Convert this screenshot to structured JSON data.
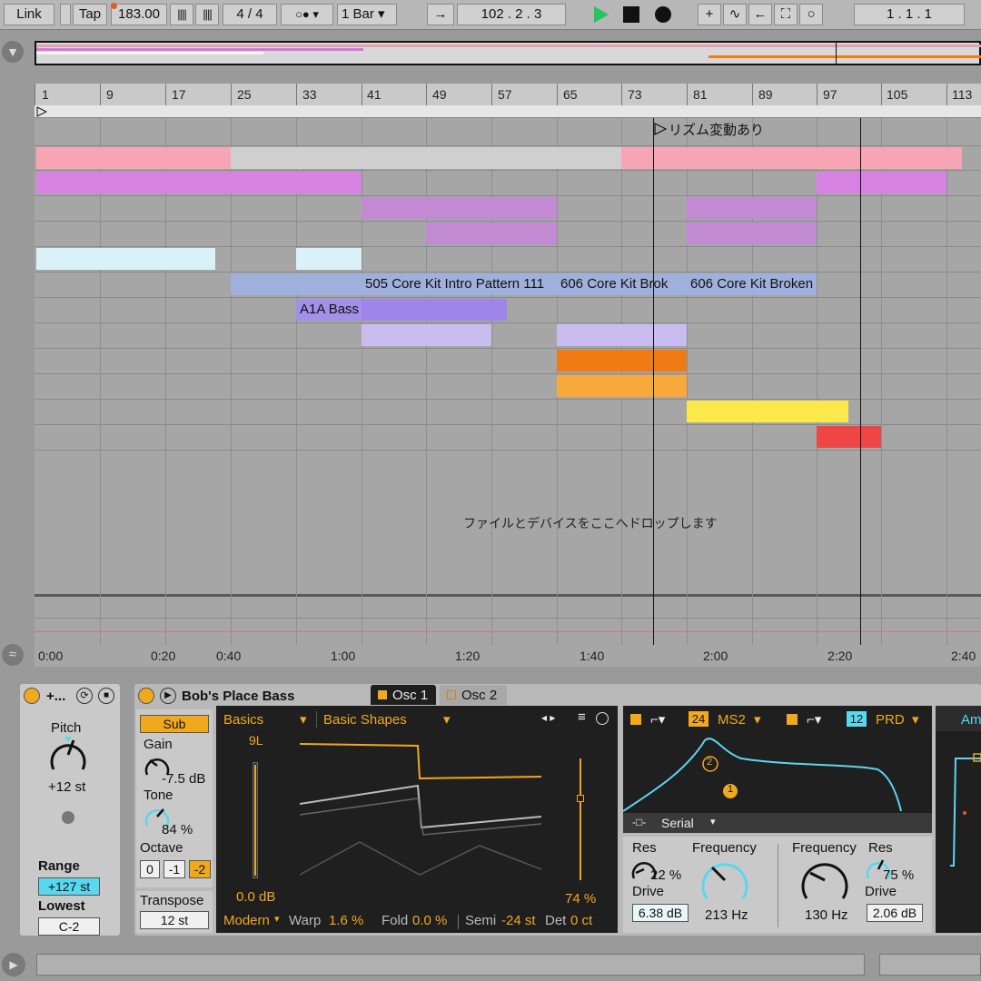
{
  "transport": {
    "link": "Link",
    "tap": "Tap",
    "tempo": "183.00",
    "time_signature": "4 / 4",
    "quantize": "1 Bar",
    "position": "102 .   2 .   3",
    "loop_start": "1 .   1 .   1"
  },
  "ruler": {
    "bars": [
      "1",
      "9",
      "17",
      "25",
      "33",
      "41",
      "49",
      "57",
      "65",
      "73",
      "81",
      "89",
      "97",
      "105",
      "113"
    ]
  },
  "arrangement": {
    "locator_label": "リズム変動あり",
    "drop_hint": "ファイルとデバイスをここへドロップします",
    "clip_labels": {
      "pattern_505": "505 Core Kit Intro Pattern 111",
      "core_606_a": "606 Core Kit Brok",
      "core_606_b": "606 Core Kit Broken",
      "a1a_bass": "A1A Bass"
    }
  },
  "timeline": {
    "times": [
      "0:00",
      "0:20",
      "0:40",
      "1:00",
      "1:20",
      "1:40",
      "2:00",
      "2:20",
      "2:40"
    ]
  },
  "pitch_device": {
    "title": "+...",
    "pitch_label": "Pitch",
    "pitch_value": "+12 st",
    "range_label": "Range",
    "range_value": "+127 st",
    "lowest_label": "Lowest",
    "lowest_value": "C-2"
  },
  "synth": {
    "name": "Bob's Place Bass",
    "tabs": [
      "Osc 1",
      "Osc 2"
    ],
    "sub_button": "Sub",
    "gain_label": "Gain",
    "gain_value": "-7.5 dB",
    "tone_label": "Tone",
    "tone_value": "84 %",
    "octave_label": "Octave",
    "octave_options": [
      "0",
      "-1",
      "-2"
    ],
    "transpose_label": "Transpose",
    "transpose_value": "12 st",
    "wavetable_category": "Basics",
    "wavetable_name": "Basic Shapes",
    "position_label": "9L",
    "level_value": "0.0 dB",
    "osc_level_pct": "74 %",
    "mode": "Modern",
    "warp_label": "Warp",
    "warp_value": "1.6 %",
    "fold_label": "Fold",
    "fold_value": "0.0 %",
    "semi_label": "Semi",
    "semi_value": "-24 st",
    "det_label": "Det",
    "det_value": "0 ct"
  },
  "filters": {
    "filter1_slope": "24",
    "filter1_type": "MS2",
    "filter2_slope": "12",
    "filter2_type": "PRD",
    "routing": "Serial",
    "node1": "1",
    "node2": "2",
    "f1_res_label": "Res",
    "f1_res_value": "22 %",
    "f1_drive_label": "Drive",
    "f1_drive_value": "6.38 dB",
    "f1_freq_label": "Frequency",
    "f1_freq_value": "213 Hz",
    "f2_freq_label": "Frequency",
    "f2_freq_value": "130 Hz",
    "f2_res_label": "Res",
    "f2_res_value": "75 %",
    "f2_drive_label": "Drive",
    "f2_drive_value": "2.06 dB",
    "amp_tab": "Am"
  },
  "colors": {
    "accent_orange": "#f0a91c",
    "play_green": "#22c55e",
    "cyan": "#5ad7f0"
  }
}
